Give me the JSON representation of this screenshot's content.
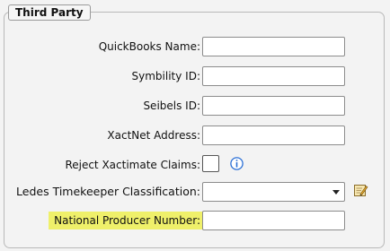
{
  "group": {
    "title": "Third Party"
  },
  "fields": {
    "quickbooks_name": {
      "label": "QuickBooks Name:",
      "value": ""
    },
    "symbility_id": {
      "label": "Symbility ID:",
      "value": ""
    },
    "seibels_id": {
      "label": "Seibels ID:",
      "value": ""
    },
    "xactnet_address": {
      "label": "XactNet Address:",
      "value": ""
    },
    "reject_xactimate_claims": {
      "label": "Reject Xactimate Claims:",
      "checked": false
    },
    "ledes_timekeeper_classification": {
      "label": "Ledes Timekeeper Classification:",
      "selected": ""
    },
    "national_producer_number": {
      "label": "National Producer Number:",
      "value": ""
    }
  },
  "icons": {
    "info": "info-icon",
    "edit": "edit-icon",
    "dropdown": "chevron-down-icon"
  },
  "colors": {
    "highlight": "#eff06a",
    "info_blue": "#2a6fd6"
  }
}
